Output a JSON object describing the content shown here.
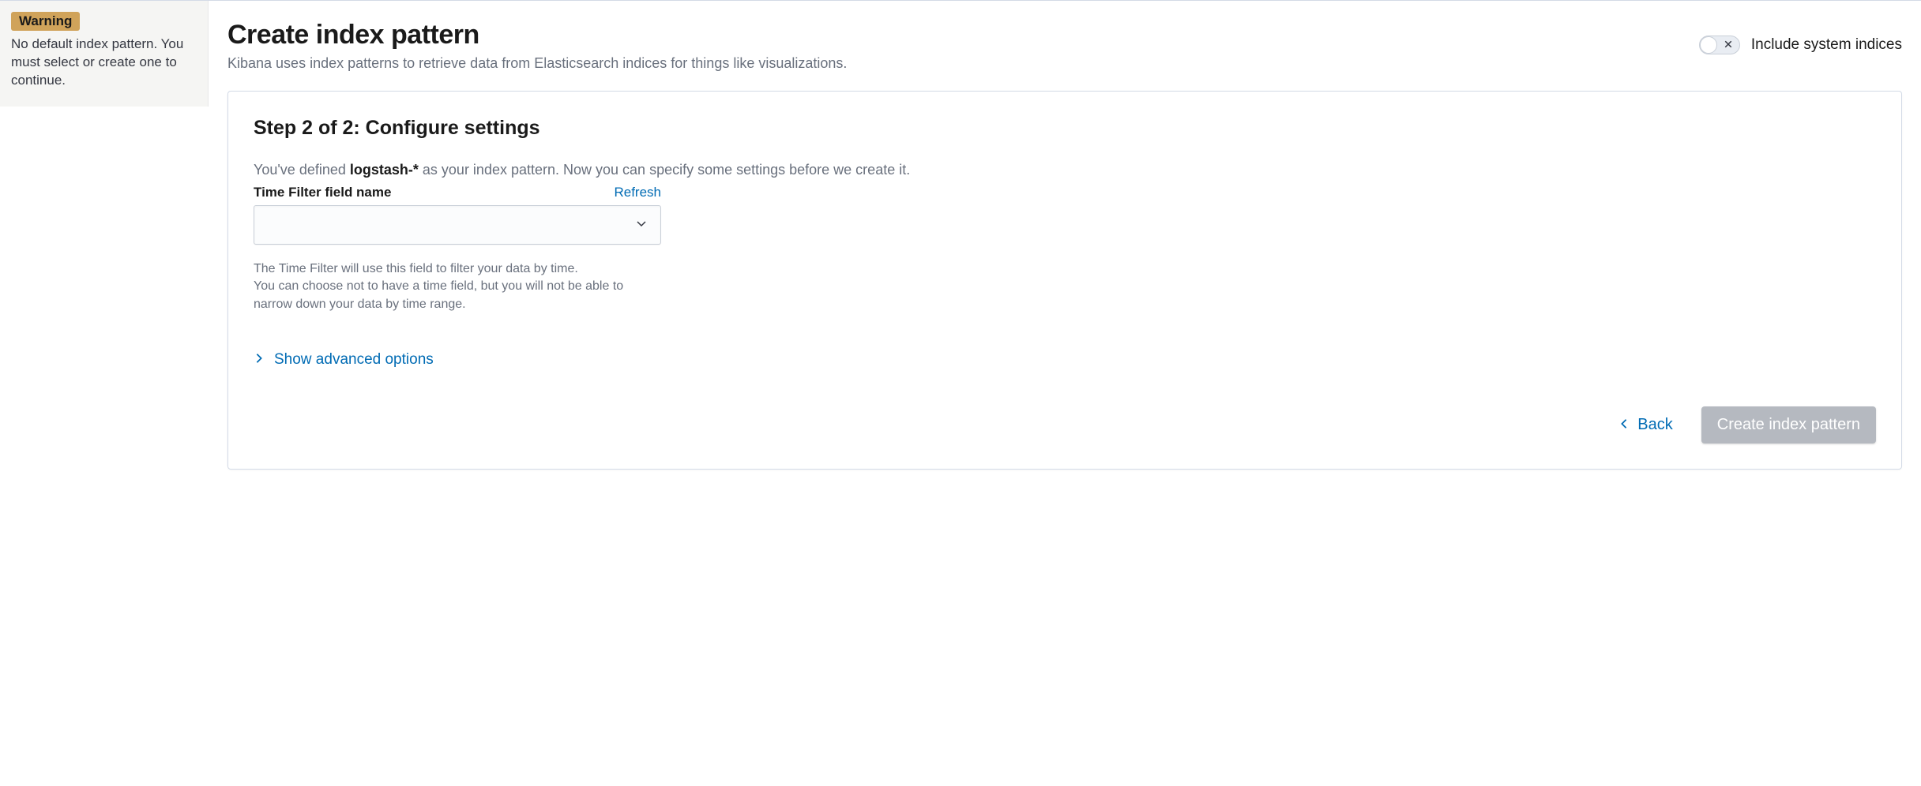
{
  "sidebar": {
    "warning_badge": "Warning",
    "warning_text": "No default index pattern. You must select or create one to continue."
  },
  "header": {
    "title": "Create index pattern",
    "subtitle": "Kibana uses index patterns to retrieve data from Elasticsearch indices for things like visualizations.",
    "toggle_label": "Include system indices",
    "toggle_state": "off"
  },
  "step": {
    "title": "Step 2 of 2: Configure settings",
    "desc_prefix": "You've defined ",
    "pattern_name": "logstash-*",
    "desc_suffix": " as your index pattern. Now you can specify some settings before we create it.",
    "field_label": "Time Filter field name",
    "refresh_label": "Refresh",
    "select_value": "",
    "help_line1": "The Time Filter will use this field to filter your data by time.",
    "help_line2": "You can choose not to have a time field, but you will not be able to narrow down your data by time range.",
    "advanced_label": "Show advanced options"
  },
  "footer": {
    "back_label": "Back",
    "create_label": "Create index pattern"
  }
}
